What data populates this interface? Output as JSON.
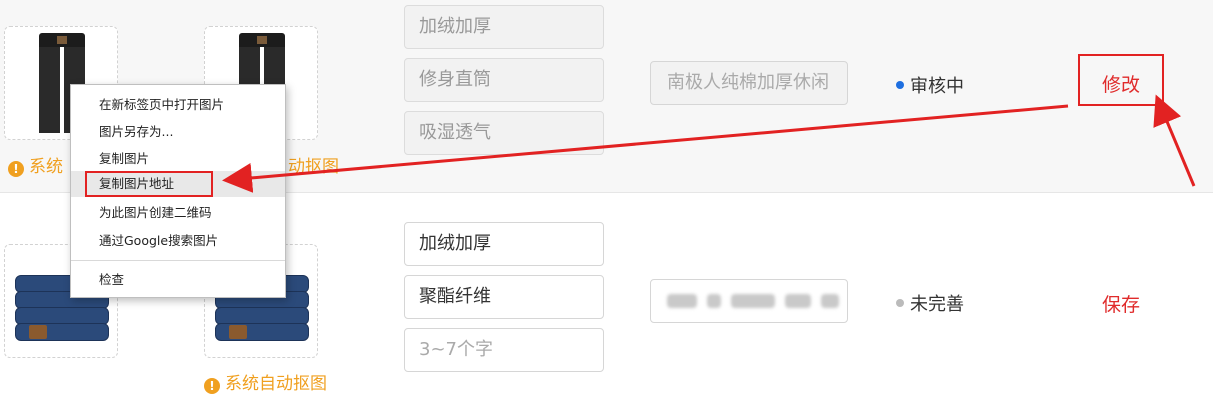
{
  "rows": [
    {
      "tags": [
        "加绒加厚",
        "修身直筒",
        "吸湿透气"
      ],
      "title": "南极人纯棉加厚休闲",
      "status": "审核中",
      "action": "修改"
    },
    {
      "tags": [
        "加绒加厚",
        "聚酯纤维"
      ],
      "tag_placeholder": "3~7个字",
      "status": "未完善",
      "action": "保存",
      "auto_cutout_label": "系统自动抠图"
    }
  ],
  "row1_partial_labels": {
    "left": "系统",
    "right": "动抠图"
  },
  "context_menu": {
    "items": [
      "在新标签页中打开图片",
      "图片另存为...",
      "复制图片",
      "复制图片地址",
      "为此图片创建二维码",
      "通过Google搜索图片",
      "检查"
    ],
    "highlighted_index": 3
  },
  "colors": {
    "accent_red": "#e02b2b",
    "warning_orange": "#f0a020",
    "status_review": "#1e6fe0",
    "status_incomplete": "#bbbbbb"
  }
}
